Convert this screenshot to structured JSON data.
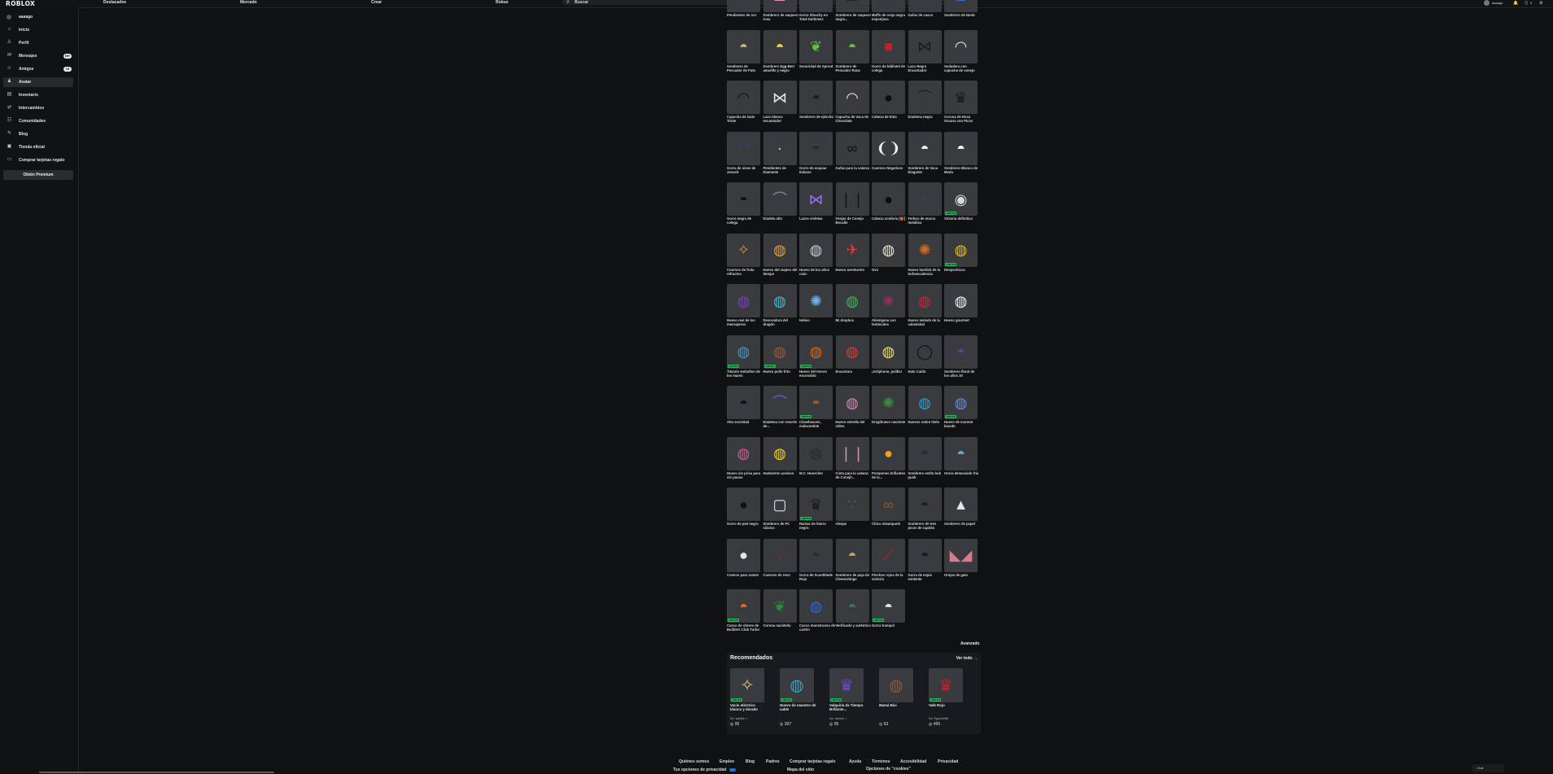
{
  "header": {
    "logo": "RŌBLOX",
    "nav": [
      "Destacados",
      "Mercado",
      "Crear",
      "Robux"
    ],
    "search_placeholder": "Buscar",
    "username": "aaaago",
    "robux_count": "0"
  },
  "sidebar": {
    "username": "aaaago",
    "items": [
      {
        "label": "Inicio",
        "icon": "home-icon",
        "badge": ""
      },
      {
        "label": "Perfil",
        "icon": "profile-icon",
        "badge": ""
      },
      {
        "label": "Mensajes",
        "icon": "mail-icon",
        "badge": "99+"
      },
      {
        "label": "Amigos",
        "icon": "friends-icon",
        "badge": "19"
      },
      {
        "label": "Avatar",
        "icon": "avatar-icon",
        "badge": ""
      },
      {
        "label": "Inventario",
        "icon": "inventory-icon",
        "badge": ""
      },
      {
        "label": "Intercambios",
        "icon": "trade-icon",
        "badge": ""
      },
      {
        "label": "Comunidades",
        "icon": "groups-icon",
        "badge": ""
      },
      {
        "label": "Blog",
        "icon": "blog-icon",
        "badge": ""
      },
      {
        "label": "Tienda oficial",
        "icon": "store-icon",
        "badge": ""
      },
      {
        "label": "Comprar tarjetas regalo",
        "icon": "giftcard-icon",
        "badge": ""
      }
    ],
    "premium_button": "Obtén Premium"
  },
  "items": [
    {
      "name": "Pendientes de oro",
      "glyph": "✦",
      "color": "#d4b24a",
      "limited": false
    },
    {
      "name": "Sombrero de vaquero rosa",
      "glyph": "⌓",
      "color": "#e48fb4",
      "limited": false
    },
    {
      "name": "Gorra Slouchy en Total Darkness",
      "glyph": "●",
      "color": "#222",
      "limited": false
    },
    {
      "name": "Sombrero de vaquero negro...",
      "glyph": "⌓",
      "color": "#222",
      "limited": false
    },
    {
      "name": "Muffs de oreja negra esponjosa",
      "glyph": "◎",
      "color": "#333",
      "limited": false
    },
    {
      "name": "Gafas de casco",
      "glyph": "∞",
      "color": "#888",
      "limited": false
    },
    {
      "name": "Sombrero de Noob",
      "glyph": "▲",
      "color": "#3a6cd6",
      "limited": false
    },
    {
      "name": "Sombrero de Pescador de Pato",
      "glyph": "◓",
      "color": "#c9b36a",
      "limited": false
    },
    {
      "name": "Sombrero Egg-Bert amarillo y negro",
      "glyph": "◓",
      "color": "#f2d23a",
      "limited": false
    },
    {
      "name": "Sonoridad de Sprout",
      "glyph": "❦",
      "color": "#5cc43a",
      "limited": false
    },
    {
      "name": "Sombrero de Pescador Rana",
      "glyph": "◓",
      "color": "#6cbd4c",
      "limited": false
    },
    {
      "name": "Gorro de bibliotel de colega",
      "glyph": "■",
      "color": "#d21c1c",
      "limited": false
    },
    {
      "name": "Lazo Negro Encantador",
      "glyph": "⋈",
      "color": "#1c1c1c",
      "limited": false
    },
    {
      "name": "Sudadera con capucha de conejo",
      "glyph": "◠",
      "color": "#e6e6e6",
      "limited": false
    },
    {
      "name": "Capucha de Gato Triste",
      "glyph": "◠",
      "color": "#111",
      "limited": false
    },
    {
      "name": "Lazo blanco encantador",
      "glyph": "⋈",
      "color": "#e6e6e6",
      "limited": false
    },
    {
      "name": "Sombrero de ejército",
      "glyph": "◓",
      "color": "#1c1c1c",
      "limited": false
    },
    {
      "name": "Capucha de Vaca de Chocolate",
      "glyph": "◠",
      "color": "#efe6d8",
      "limited": false
    },
    {
      "name": "Cabeza de tinta",
      "glyph": "●",
      "color": "#0d0d0d",
      "limited": false
    },
    {
      "name": "Diadema negra",
      "glyph": "⌒",
      "color": "#222",
      "limited": false
    },
    {
      "name": "Corona de Rosa Oscura con Picos",
      "glyph": "♛",
      "color": "#1a1a1a",
      "limited": false
    },
    {
      "name": "Gorra de nieve de Jesusit",
      "glyph": "◠",
      "color": "#2b3ea8",
      "limited": false
    },
    {
      "name": "Pendientes de Diamante",
      "glyph": "·",
      "color": "#cfe7ff",
      "limited": false
    },
    {
      "name": "Gorro de esquiar Italiano",
      "glyph": "◓",
      "color": "#2a2a2a",
      "limited": false
    },
    {
      "name": "Gafas para la cabeza",
      "glyph": "∞",
      "color": "#111",
      "limited": false
    },
    {
      "name": "Cuernos Negativos",
      "glyph": "❨❩",
      "color": "#eee",
      "limited": false
    },
    {
      "name": "Sombrero de Vaca Elegante",
      "glyph": "◓",
      "color": "#f0f0f0",
      "limited": false
    },
    {
      "name": "Sombrero Blanco de Moda",
      "glyph": "◓",
      "color": "#f4f4f4",
      "limited": false
    },
    {
      "name": "Gorra negra de colega",
      "glyph": "◓",
      "color": "#111",
      "limited": false
    },
    {
      "name": "Diadela alto",
      "glyph": "⌒",
      "color": "#888",
      "limited": false
    },
    {
      "name": "Lazos violetas",
      "glyph": "⋈",
      "color": "#9a6ef0",
      "limited": false
    },
    {
      "name": "Orejas de Conejo Bocalle",
      "glyph": "❘❘",
      "color": "#111",
      "limited": false
    },
    {
      "name": "Cabeza sombría [🎁]",
      "glyph": "●",
      "color": "#0c0c0c",
      "limited": false
    },
    {
      "name": "Fedora de marco metálico",
      "glyph": "◓",
      "color": "#3c3f56",
      "limited": false
    },
    {
      "name": "Victoria definitiva",
      "glyph": "◉",
      "color": "#d8d8d8",
      "limited": true
    },
    {
      "name": "Cuernos de fruta refractos",
      "glyph": "✧",
      "color": "#d88a3a",
      "limited": false
    },
    {
      "name": "Huevo del viajero del tiempo",
      "glyph": "◍",
      "color": "#e0a23a",
      "limited": false
    },
    {
      "name": "Huevo de los años caóc",
      "glyph": "◍",
      "color": "#cfcfcf",
      "limited": false
    },
    {
      "name": "Huevo aventurero",
      "glyph": "✈",
      "color": "#e23a3a",
      "limited": false
    },
    {
      "name": "Ovo",
      "glyph": "◍",
      "color": "#f4e6d6",
      "limited": false
    },
    {
      "name": "Huevo hardick de la bofoescalencia",
      "glyph": "✺",
      "color": "#c76b2f",
      "limited": false
    },
    {
      "name": "Despechicos",
      "glyph": "◍",
      "color": "#e0c21a",
      "limited": true
    },
    {
      "name": "Huevo real de los mensajeros",
      "glyph": "◍",
      "color": "#7a3ad2",
      "limited": false
    },
    {
      "name": "Devoradura del dragón",
      "glyph": "◍",
      "color": "#3ac0d2",
      "limited": false
    },
    {
      "name": "Helioo",
      "glyph": "✺",
      "color": "#6ab0f0",
      "limited": false
    },
    {
      "name": "Mi dropbox",
      "glyph": "◍",
      "color": "#3ab85a",
      "limited": false
    },
    {
      "name": "Alienígena con tentáculos",
      "glyph": "✺",
      "color": "#9a2a5a",
      "limited": false
    },
    {
      "name": "Huevo melado de la calamidad",
      "glyph": "◍",
      "color": "#d2223a",
      "limited": false
    },
    {
      "name": "Huevo gourmet",
      "glyph": "◍",
      "color": "#f2f2f2",
      "limited": false
    },
    {
      "name": "Titanón embullon de los mares",
      "glyph": "◍",
      "color": "#3a9ad2",
      "limited": true
    },
    {
      "name": "Huevo pollo frito",
      "glyph": "◍",
      "color": "#a25a2a",
      "limited": true
    },
    {
      "name": "Huevo del tesoro escondido",
      "glyph": "◍",
      "color": "#d26a1a",
      "limited": true
    },
    {
      "name": "Encantora",
      "glyph": "◍",
      "color": "#e23a3a",
      "limited": false
    },
    {
      "name": "¡Artiphone, polilla!",
      "glyph": "◍",
      "color": "#f2e25a",
      "limited": false
    },
    {
      "name": "Halo Caído",
      "glyph": "◯",
      "color": "#111",
      "limited": false
    },
    {
      "name": "Sombrero floral de los años 30",
      "glyph": "◓",
      "color": "#6a3aa2",
      "limited": false
    },
    {
      "name": "Alta sociedad",
      "glyph": "◓",
      "color": "#111",
      "limited": false
    },
    {
      "name": "Diadema con resorte de...",
      "glyph": "⌒",
      "color": "#6a5ad2",
      "limited": false
    },
    {
      "name": "Claveheaven, malacombie",
      "glyph": "◓",
      "color": "#a25a2a",
      "limited": true
    },
    {
      "name": "Huevo estrella del vídeo",
      "glyph": "◍",
      "color": "#d28ab2",
      "limited": false
    },
    {
      "name": "Dragihuevo naciente",
      "glyph": "✺",
      "color": "#3a8a3a",
      "limited": false
    },
    {
      "name": "Huevos sobre hielo",
      "glyph": "◍",
      "color": "#3a9ad2",
      "limited": false
    },
    {
      "name": "Huevo de marmot lanudo",
      "glyph": "◍",
      "color": "#6a8ad2",
      "limited": true
    },
    {
      "name": "Huevo sin prisa para sin pausa",
      "glyph": "◍",
      "color": "#d25a8a",
      "limited": false
    },
    {
      "name": "Huebotrón asesino",
      "glyph": "◍",
      "color": "#f2d21a",
      "limited": false
    },
    {
      "name": "M.C. Huevcher",
      "glyph": "◍",
      "color": "#2a2a2a",
      "limited": false
    },
    {
      "name": "Cinta para la cabeza de Conejit...",
      "glyph": "❘❘",
      "color": "#d89ab2",
      "limited": false
    },
    {
      "name": "Pompones brillantes de la...",
      "glyph": "●",
      "color": "#f2a21a",
      "limited": false
    },
    {
      "name": "Sombrero estilo bob punk",
      "glyph": "◓",
      "color": "#2a2a2a",
      "limited": false
    },
    {
      "name": "Gorra demasiado fría",
      "glyph": "◓",
      "color": "#6aaad2",
      "limited": false
    },
    {
      "name": "Gorro de piel negro",
      "glyph": "●",
      "color": "#111",
      "limited": false
    },
    {
      "name": "Sombrero de PC clásico",
      "glyph": "▢",
      "color": "#e6e6e6",
      "limited": false
    },
    {
      "name": "Ramas de hierro negro",
      "glyph": "♛",
      "color": "#1a1a1a",
      "limited": true
    },
    {
      "name": "Abejas",
      "glyph": "∵",
      "color": "#555",
      "limited": false
    },
    {
      "name": "Chico steampunk",
      "glyph": "∞",
      "color": "#8a5a2a",
      "limited": false
    },
    {
      "name": "Sombrero de tres picos de capitán",
      "glyph": "◓",
      "color": "#2a1a1a",
      "limited": false
    },
    {
      "name": "Sombrero de papel",
      "glyph": "▲",
      "color": "#e6e6e6",
      "limited": false
    },
    {
      "name": "Cuenco para ramen",
      "glyph": "●",
      "color": "#e6e6e6",
      "limited": false
    },
    {
      "name": "Cuernos de reno",
      "glyph": "⋎",
      "color": "#5a3a2a",
      "limited": false
    },
    {
      "name": "Gorra de Scantblade Rojo",
      "glyph": "◓",
      "color": "#2a2a2a",
      "limited": false
    },
    {
      "name": "Sombrero de paja de Cheeechings",
      "glyph": "◓",
      "color": "#c8a26a",
      "limited": false
    },
    {
      "name": "Pinchos rojos de la victoria",
      "glyph": "⟋",
      "color": "#d21a1a",
      "limited": false
    },
    {
      "name": "Gorra de espía evidente",
      "glyph": "◓",
      "color": "#1a1a1a",
      "limited": false
    },
    {
      "name": "Orejas de gato",
      "glyph": "◣◢",
      "color": "#d87a8a",
      "limited": false
    },
    {
      "name": "Casco de obrero de Builders Club Turbo",
      "glyph": "◓",
      "color": "#e26a1a",
      "limited": true
    },
    {
      "name": "Corona navideña",
      "glyph": "❦",
      "color": "#2a8a3a",
      "limited": false
    },
    {
      "name": "Casco monstruoso de cartón",
      "glyph": "◍",
      "color": "#2a6ad2",
      "limited": false
    },
    {
      "name": "Verificado y auténtico",
      "glyph": "◓",
      "color": "#3a7a4a",
      "limited": false
    },
    {
      "name": "Gorra tranquil",
      "glyph": "◓",
      "color": "#e6e6e6",
      "limited": true
    }
  ],
  "advanced_link": "Avanzado",
  "recommended": {
    "title": "Recomendados",
    "see_all": "Ver todo →",
    "items": [
      {
        "name": "Vacío eléctrico blanco y dorado",
        "creator": "De: Icarlink ✓",
        "price": "◎ 95",
        "glyph": "✧",
        "color": "#e6c27a",
        "limited": true
      },
      {
        "name": "Huevo de maestro de sable",
        "creator": "",
        "price": "◎ 397",
        "glyph": "◍",
        "color": "#3aa2c2",
        "limited": true
      },
      {
        "name": "Valquiria de Tiempo Brillante...",
        "creator": "De: Iceclon ✓",
        "price": "◎ 95",
        "glyph": "♛",
        "color": "#6a4ad2",
        "limited": true
      },
      {
        "name": "Mamá Bixi",
        "creator": "",
        "price": "◎ 63",
        "glyph": "◍",
        "color": "#8a5a3a",
        "limited": false
      },
      {
        "name": "Valk Rojo",
        "creator": "De: Egorrel286",
        "price": "◎ 495",
        "glyph": "♛",
        "color": "#d21a2a",
        "limited": true
      }
    ]
  },
  "footer": {
    "links": [
      "Quiénes somos",
      "Empleo",
      "Blog",
      "Padres",
      "Comprar tarjetas regalo",
      "Ayuda",
      "Términos",
      "Accesibilidad",
      "Privacidad"
    ],
    "privacy_choices": "Tus opciones de privacidad",
    "sitemap": "Mapa del sitio",
    "cookies": "Opciones de \"cookies\""
  },
  "chat_label": "Chat",
  "limited_tag": "LIMITED"
}
